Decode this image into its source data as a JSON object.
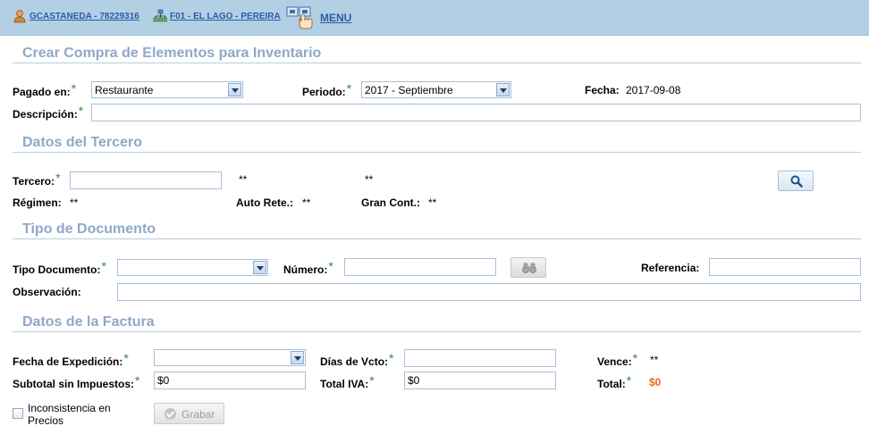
{
  "header": {
    "user_link": "GCASTANEDA - 78229316",
    "branch_link": "F01 - EL LAGO - PEREIRA",
    "menu_link": "MENU"
  },
  "sections": {
    "main_title": "Crear Compra de Elementos para Inventario",
    "tercero_title": "Datos del Tercero",
    "documento_title": "Tipo de Documento",
    "factura_title": "Datos de la Factura"
  },
  "compra": {
    "pagado_en_label": "Pagado en:",
    "pagado_en_value": "Restaurante",
    "periodo_label": "Periodo:",
    "periodo_value": "2017 - Septiembre",
    "fecha_label": "Fecha:",
    "fecha_value": "2017-09-08",
    "descripcion_label": "Descripción:",
    "descripcion_value": ""
  },
  "tercero": {
    "tercero_label": "Tercero:",
    "tercero_value": "",
    "placeholder_1": "**",
    "placeholder_2": "**",
    "regimen_label": "Régimen:",
    "regimen_value": "**",
    "auto_rete_label": "Auto Rete.:",
    "auto_rete_value": "**",
    "gran_cont_label": "Gran Cont.:",
    "gran_cont_value": "**"
  },
  "documento": {
    "tipo_label": "Tipo Documento:",
    "tipo_value": "",
    "numero_label": "Número:",
    "numero_value": "",
    "referencia_label": "Referencia:",
    "referencia_value": "",
    "observacion_label": "Observación:",
    "observacion_value": ""
  },
  "factura": {
    "fecha_exp_label": "Fecha de Expedición:",
    "fecha_exp_value": "",
    "dias_vcto_label": "Días de Vcto:",
    "dias_vcto_value": "",
    "vence_label": "Vence:",
    "vence_value": "**",
    "subtotal_label": "Subtotal sin Impuestos:",
    "subtotal_value": "$0",
    "total_iva_label": "Total IVA:",
    "total_iva_value": "$0",
    "total_label": "Total:",
    "total_value": "$0"
  },
  "footer": {
    "inconsistencia_label": "Inconsistencia en Precios",
    "grabar_label": "Grabar"
  },
  "required_mark": "*",
  "colors": {
    "topbar": "#b3cfe3",
    "section_title": "#8fa8c8",
    "link": "#2a5ca8",
    "required": "#2e8b57",
    "total": "#e86a1f"
  }
}
